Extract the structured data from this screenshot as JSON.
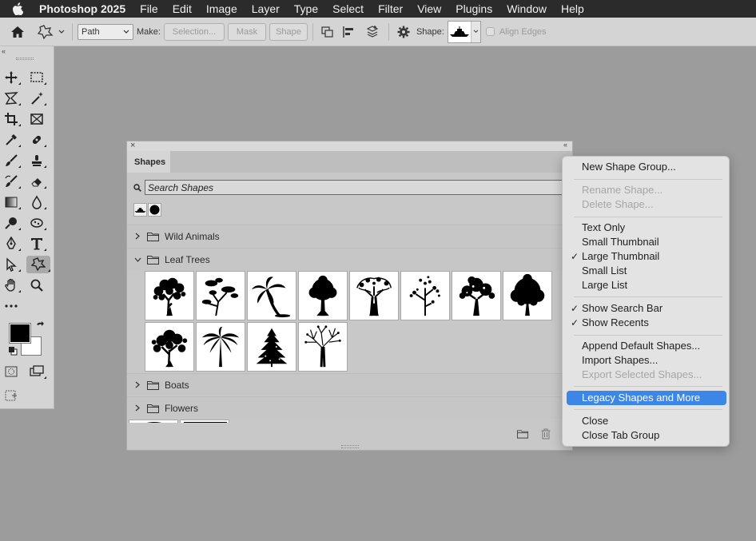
{
  "menubar": {
    "app_name": "Photoshop 2025",
    "items": [
      "File",
      "Edit",
      "Image",
      "Layer",
      "Type",
      "Select",
      "Filter",
      "View",
      "Plugins",
      "Window",
      "Help"
    ]
  },
  "options_bar": {
    "mode_value": "Path",
    "make_label": "Make:",
    "selection_label": "Selection...",
    "mask_label": "Mask",
    "shape_btn_label": "Shape",
    "shape_label": "Shape:",
    "align_edges_label": "Align Edges"
  },
  "shapes_panel": {
    "tab_label": "Shapes",
    "search_placeholder": "Search Shapes",
    "groups": [
      {
        "name": "Wild Animals",
        "expanded": false
      },
      {
        "name": "Leaf Trees",
        "expanded": true
      },
      {
        "name": "Boats",
        "expanded": false
      },
      {
        "name": "Flowers",
        "expanded": false
      }
    ]
  },
  "context_menu": {
    "items": [
      {
        "label": "New Shape Group...",
        "disabled": false,
        "checked": false
      },
      {
        "label": "Rename Shape...",
        "disabled": true,
        "checked": false
      },
      {
        "label": "Delete Shape...",
        "disabled": true,
        "checked": false
      },
      {
        "label": "Text Only",
        "disabled": false,
        "checked": false
      },
      {
        "label": "Small Thumbnail",
        "disabled": false,
        "checked": false
      },
      {
        "label": "Large Thumbnail",
        "disabled": false,
        "checked": true
      },
      {
        "label": "Small List",
        "disabled": false,
        "checked": false
      },
      {
        "label": "Large List",
        "disabled": false,
        "checked": false
      },
      {
        "label": "Show Search Bar",
        "disabled": false,
        "checked": true
      },
      {
        "label": "Show Recents",
        "disabled": false,
        "checked": true
      },
      {
        "label": "Append Default Shapes...",
        "disabled": false,
        "checked": false
      },
      {
        "label": "Import Shapes...",
        "disabled": false,
        "checked": false
      },
      {
        "label": "Export Selected Shapes...",
        "disabled": true,
        "checked": false
      },
      {
        "label": "Legacy Shapes and More",
        "disabled": false,
        "checked": false,
        "highlighted": true
      },
      {
        "label": "Close",
        "disabled": false,
        "checked": false
      },
      {
        "label": "Close Tab Group",
        "disabled": false,
        "checked": false
      }
    ],
    "check_glyph": "✓",
    "highlight_color": "#3c86e8"
  }
}
